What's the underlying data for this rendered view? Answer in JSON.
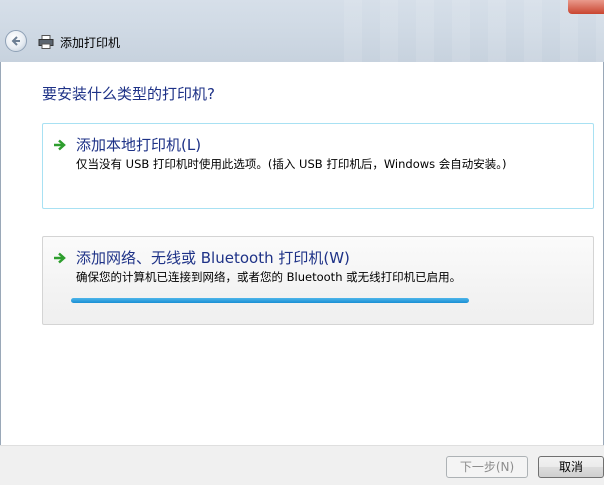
{
  "window": {
    "title": "添加打印机"
  },
  "heading": "要安装什么类型的打印机?",
  "options": [
    {
      "title": "添加本地打印机(L)",
      "description": "仅当没有 USB 打印机时使用此选项。(插入 USB 打印机后，Windows 会自动安装。)"
    },
    {
      "title": "添加网络、无线或 Bluetooth 打印机(W)",
      "description": "确保您的计算机已连接到网络，或者您的 Bluetooth 或无线打印机已启用。"
    }
  ],
  "buttons": {
    "next": "下一步(N)",
    "cancel": "取消"
  },
  "colors": {
    "heading_text": "#1e3287",
    "progress": "#1a8fd4",
    "arrow_green": "#2e9e2e"
  },
  "icons": {
    "back": "back-arrow-icon",
    "printer": "printer-icon",
    "option_arrow": "green-arrow-icon"
  }
}
